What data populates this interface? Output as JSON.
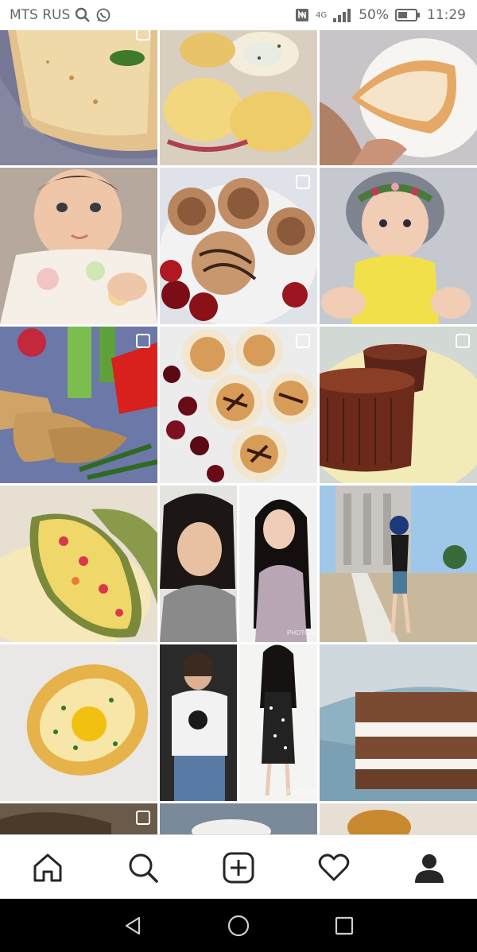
{
  "status_bar": {
    "carrier": "MTS RUS",
    "network": "4G",
    "battery_percent": "50%",
    "time": "11:29",
    "icons": [
      "search-icon",
      "whatsapp-icon",
      "nfc-icon",
      "signal-icon",
      "battery-icon"
    ]
  },
  "grid": {
    "tiles": [
      {
        "subject": "lasagna-photo",
        "multi": true
      },
      {
        "subject": "stuffed-rolls-photo",
        "multi": false
      },
      {
        "subject": "cheesecake-slice-photo",
        "multi": false
      },
      {
        "subject": "baby-photo",
        "multi": false
      },
      {
        "subject": "chocolate-crepe-rolls-photo",
        "multi": true
      },
      {
        "subject": "baby-flower-crown-photo",
        "multi": false
      },
      {
        "subject": "breaded-chicken-vegetables-photo",
        "multi": true
      },
      {
        "subject": "syrniki-cherries-photo",
        "multi": true
      },
      {
        "subject": "chocolate-dessert-photo",
        "multi": true
      },
      {
        "subject": "stuffed-zucchini-photo",
        "multi": false
      },
      {
        "subject": "before-after-photo",
        "multi": false
      },
      {
        "subject": "woman-city-walk-photo",
        "multi": false
      },
      {
        "subject": "khachapuri-photo",
        "multi": false
      },
      {
        "subject": "before-after-photo-2",
        "multi": false
      },
      {
        "subject": "layered-cake-photo",
        "multi": false
      }
    ],
    "watermark_text": "PHOTO EDITOR"
  },
  "bottom_nav": {
    "items": [
      "home-icon",
      "search-icon",
      "new-post-icon",
      "activity-icon",
      "profile-icon"
    ]
  },
  "android_nav": {
    "items": [
      "back-icon",
      "home-circle-icon",
      "recents-icon"
    ]
  },
  "colors": {
    "status_text": "#666666",
    "nav_icon": "#262626",
    "android_bar": "#000000"
  }
}
